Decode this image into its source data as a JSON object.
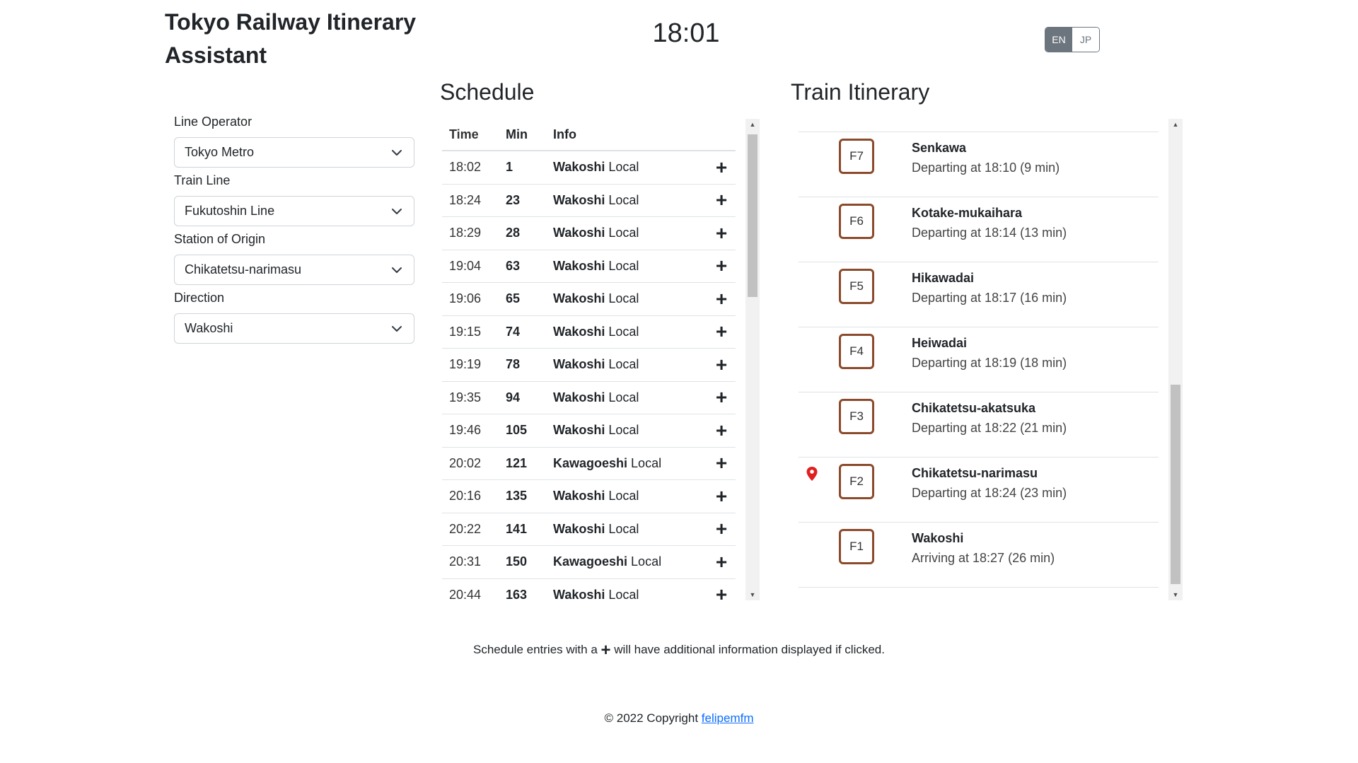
{
  "header": {
    "title": "Tokyo Railway Itinerary Assistant",
    "clock": "18:01",
    "lang_en": "EN",
    "lang_jp": "JP"
  },
  "form": {
    "operator_label": "Line Operator",
    "operator_value": "Tokyo Metro",
    "line_label": "Train Line",
    "line_value": "Fukutoshin Line",
    "origin_label": "Station of Origin",
    "origin_value": "Chikatetsu-narimasu",
    "direction_label": "Direction",
    "direction_value": "Wakoshi"
  },
  "schedule": {
    "title": "Schedule",
    "headers": {
      "time": "Time",
      "min": "Min",
      "info": "Info"
    },
    "rows": [
      {
        "time": "18:02",
        "min": "1",
        "dest": "Wakoshi",
        "type": "Local"
      },
      {
        "time": "18:24",
        "min": "23",
        "dest": "Wakoshi",
        "type": "Local"
      },
      {
        "time": "18:29",
        "min": "28",
        "dest": "Wakoshi",
        "type": "Local"
      },
      {
        "time": "19:04",
        "min": "63",
        "dest": "Wakoshi",
        "type": "Local"
      },
      {
        "time": "19:06",
        "min": "65",
        "dest": "Wakoshi",
        "type": "Local"
      },
      {
        "time": "19:15",
        "min": "74",
        "dest": "Wakoshi",
        "type": "Local"
      },
      {
        "time": "19:19",
        "min": "78",
        "dest": "Wakoshi",
        "type": "Local"
      },
      {
        "time": "19:35",
        "min": "94",
        "dest": "Wakoshi",
        "type": "Local"
      },
      {
        "time": "19:46",
        "min": "105",
        "dest": "Wakoshi",
        "type": "Local"
      },
      {
        "time": "20:02",
        "min": "121",
        "dest": "Kawagoeshi",
        "type": "Local"
      },
      {
        "time": "20:16",
        "min": "135",
        "dest": "Wakoshi",
        "type": "Local"
      },
      {
        "time": "20:22",
        "min": "141",
        "dest": "Wakoshi",
        "type": "Local"
      },
      {
        "time": "20:31",
        "min": "150",
        "dest": "Kawagoeshi",
        "type": "Local"
      },
      {
        "time": "20:44",
        "min": "163",
        "dest": "Wakoshi",
        "type": "Local"
      }
    ],
    "plus": "+"
  },
  "itinerary": {
    "title": "Train Itinerary",
    "stops": [
      {
        "code": "F7",
        "name": "Senkawa",
        "time": "Departing at 18:10 (9 min)"
      },
      {
        "code": "F6",
        "name": "Kotake-mukaihara",
        "time": "Departing at 18:14 (13 min)"
      },
      {
        "code": "F5",
        "name": "Hikawadai",
        "time": "Departing at 18:17 (16 min)"
      },
      {
        "code": "F4",
        "name": "Heiwadai",
        "time": "Departing at 18:19 (18 min)"
      },
      {
        "code": "F3",
        "name": "Chikatetsu-akatsuka",
        "time": "Departing at 18:22 (21 min)"
      },
      {
        "code": "F2",
        "name": "Chikatetsu-narimasu",
        "time": "Departing at 18:24 (23 min)",
        "origin": true
      },
      {
        "code": "F1",
        "name": "Wakoshi",
        "time": "Arriving at 18:27 (26 min)"
      }
    ]
  },
  "note": {
    "before": "Schedule entries with a",
    "after": "will have additional information displayed if clicked."
  },
  "footer": {
    "text": "© 2022 Copyright",
    "link": "felipemfm"
  },
  "colors": {
    "line_brown": "#8b4a2b",
    "pin_red": "#e0201e",
    "toggle_gray": "#6c757d",
    "link_blue": "#0d6efd"
  }
}
